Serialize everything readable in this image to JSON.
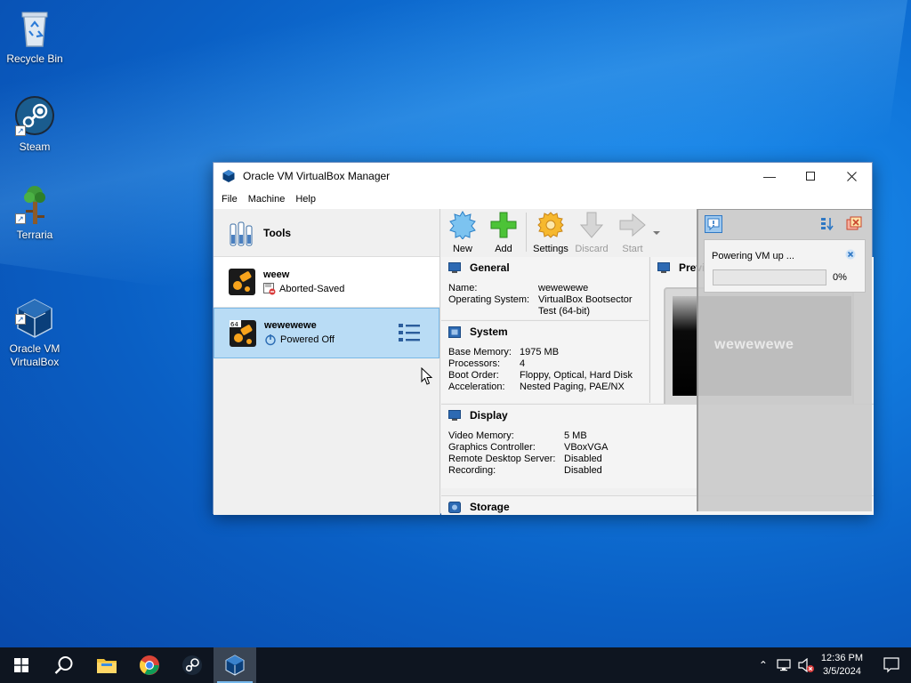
{
  "desktop": {
    "icons": [
      {
        "label": "Recycle Bin"
      },
      {
        "label": "Steam"
      },
      {
        "label": "Terraria"
      },
      {
        "label": "Oracle VM\nVirtualBox"
      }
    ]
  },
  "window": {
    "title": "Oracle VM VirtualBox Manager",
    "menu": [
      "File",
      "Machine",
      "Help"
    ]
  },
  "left_pane": {
    "tools_label": "Tools",
    "vms": [
      {
        "name": "weew",
        "state": "Aborted-Saved",
        "badge": ""
      },
      {
        "name": "wewewewe",
        "state": "Powered Off",
        "badge": "64"
      }
    ]
  },
  "toolbar": {
    "new": "New",
    "add": "Add",
    "settings": "Settings",
    "discard": "Discard",
    "start": "Start"
  },
  "details": {
    "general": {
      "title": "General",
      "name_k": "Name:",
      "name_v": "wewewewe",
      "os_k": "Operating System:",
      "os_v1": "VirtualBox Bootsector",
      "os_v2": "Test (64-bit)"
    },
    "system": {
      "title": "System",
      "rows": [
        {
          "k": "Base Memory:",
          "v": "1975 MB"
        },
        {
          "k": "Processors:",
          "v": "4"
        },
        {
          "k": "Boot Order:",
          "v": "Floppy, Optical, Hard Disk"
        },
        {
          "k": "Acceleration:",
          "v": "Nested Paging, PAE/NX"
        }
      ]
    },
    "display": {
      "title": "Display",
      "rows": [
        {
          "k": "Video Memory:",
          "v": "5 MB"
        },
        {
          "k": "Graphics Controller:",
          "v": "VBoxVGA"
        },
        {
          "k": "Remote Desktop Server:",
          "v": "Disabled"
        },
        {
          "k": "Recording:",
          "v": "Disabled"
        }
      ]
    },
    "storage": {
      "title": "Storage"
    },
    "preview": {
      "title": "Previ"
    }
  },
  "notification": {
    "text": "Powering VM up ...",
    "percent": "0%",
    "progress_fraction": 0.0,
    "preview_name": "wewewewe"
  },
  "taskbar": {
    "time": "12:36 PM",
    "date": "3/5/2024",
    "pinned": [
      "start-button",
      "search-button",
      "file-explorer",
      "chrome",
      "steam",
      "virtualbox"
    ]
  },
  "colors": {
    "accent": "#0078d7",
    "selection": "#b9dcf5",
    "progress": "#06b025"
  }
}
